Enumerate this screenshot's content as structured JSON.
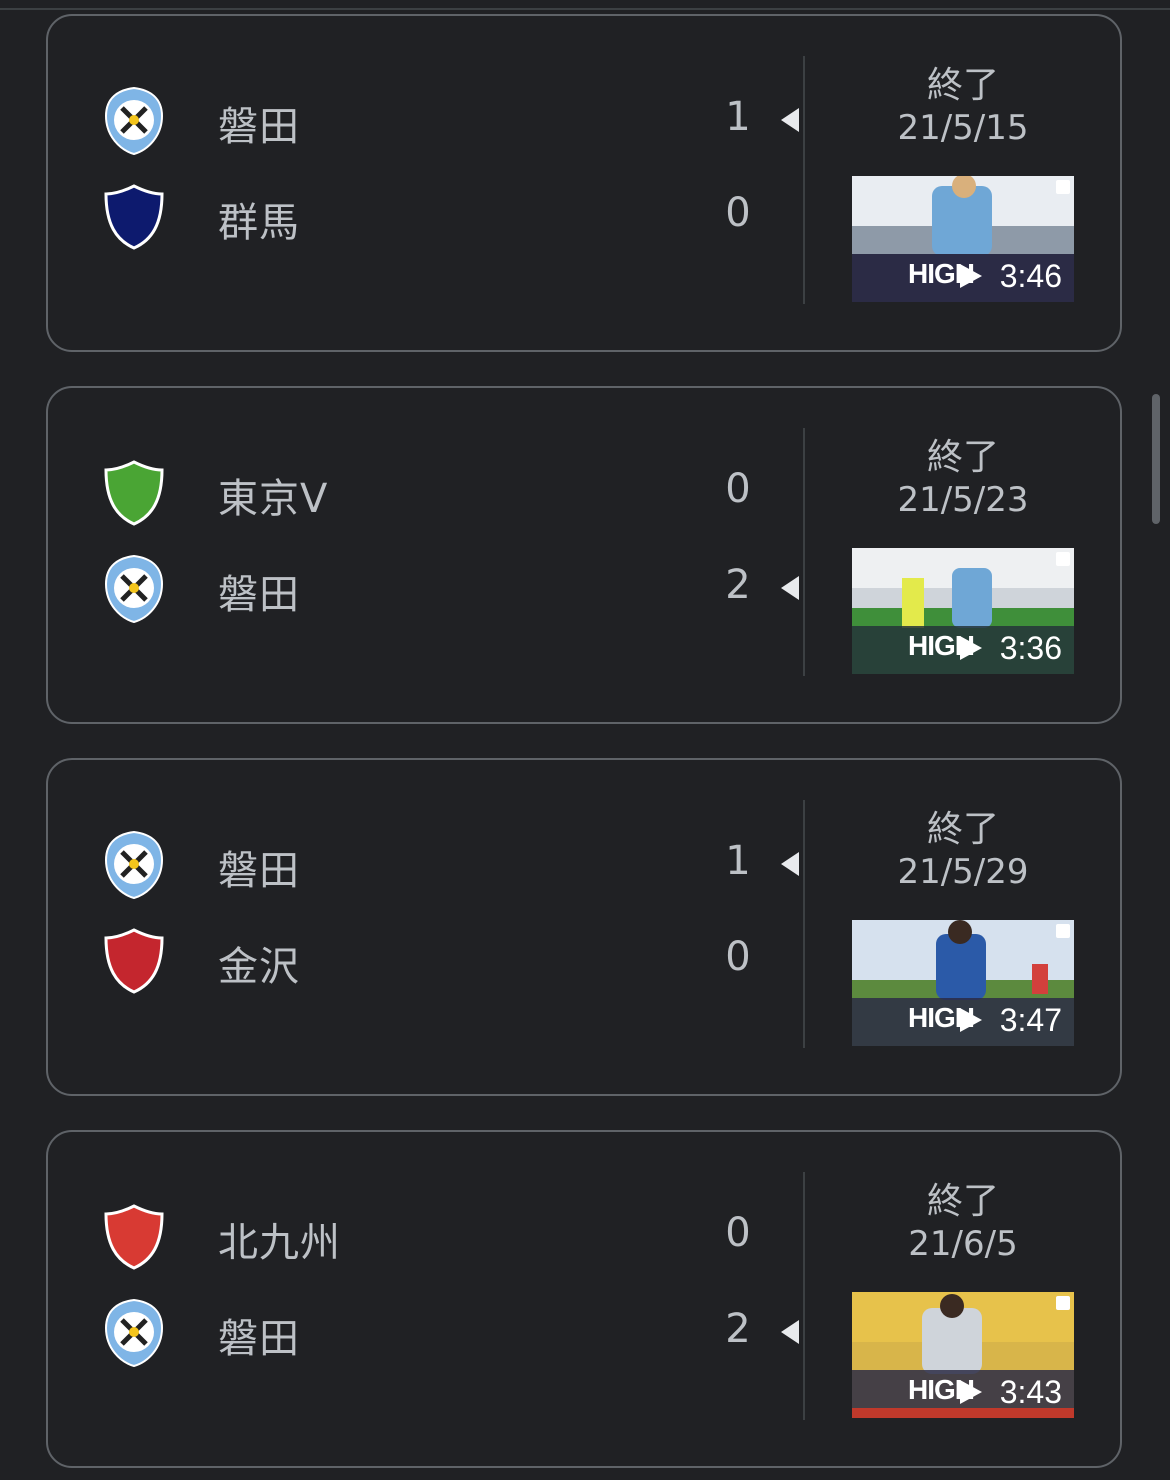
{
  "colors": {
    "background": "#202124",
    "card_border": "#5f6368",
    "text": "#bdc1c6",
    "crest_jubilo": "#7fb5e6",
    "crest_gunma": "#0d1a6e",
    "crest_tokyov": "#4aa534",
    "crest_kanazawa": "#c4262e",
    "crest_kitakyushu": "#d83a33"
  },
  "matches": [
    {
      "home": {
        "name": "磐田",
        "score": "1",
        "crest": "jubilo-crest-icon",
        "winner": true
      },
      "away": {
        "name": "群馬",
        "score": "0",
        "crest": "gunma-shield-icon",
        "winner": false
      },
      "status": "終了",
      "date": "21/5/15",
      "video": {
        "label": "HIGH",
        "duration": "3:46"
      }
    },
    {
      "home": {
        "name": "東京V",
        "score": "0",
        "crest": "tokyov-shield-icon",
        "winner": false
      },
      "away": {
        "name": "磐田",
        "score": "2",
        "crest": "jubilo-crest-icon",
        "winner": true
      },
      "status": "終了",
      "date": "21/5/23",
      "video": {
        "label": "HIGH",
        "duration": "3:36"
      }
    },
    {
      "home": {
        "name": "磐田",
        "score": "1",
        "crest": "jubilo-crest-icon",
        "winner": true
      },
      "away": {
        "name": "金沢",
        "score": "0",
        "crest": "kanazawa-shield-icon",
        "winner": false
      },
      "status": "終了",
      "date": "21/5/29",
      "video": {
        "label": "HIGH",
        "duration": "3:47"
      }
    },
    {
      "home": {
        "name": "北九州",
        "score": "0",
        "crest": "kitakyushu-shield-icon",
        "winner": false
      },
      "away": {
        "name": "磐田",
        "score": "2",
        "crest": "jubilo-crest-icon",
        "winner": true
      },
      "status": "終了",
      "date": "21/6/5",
      "video": {
        "label": "HIGH",
        "duration": "3:43"
      }
    }
  ]
}
